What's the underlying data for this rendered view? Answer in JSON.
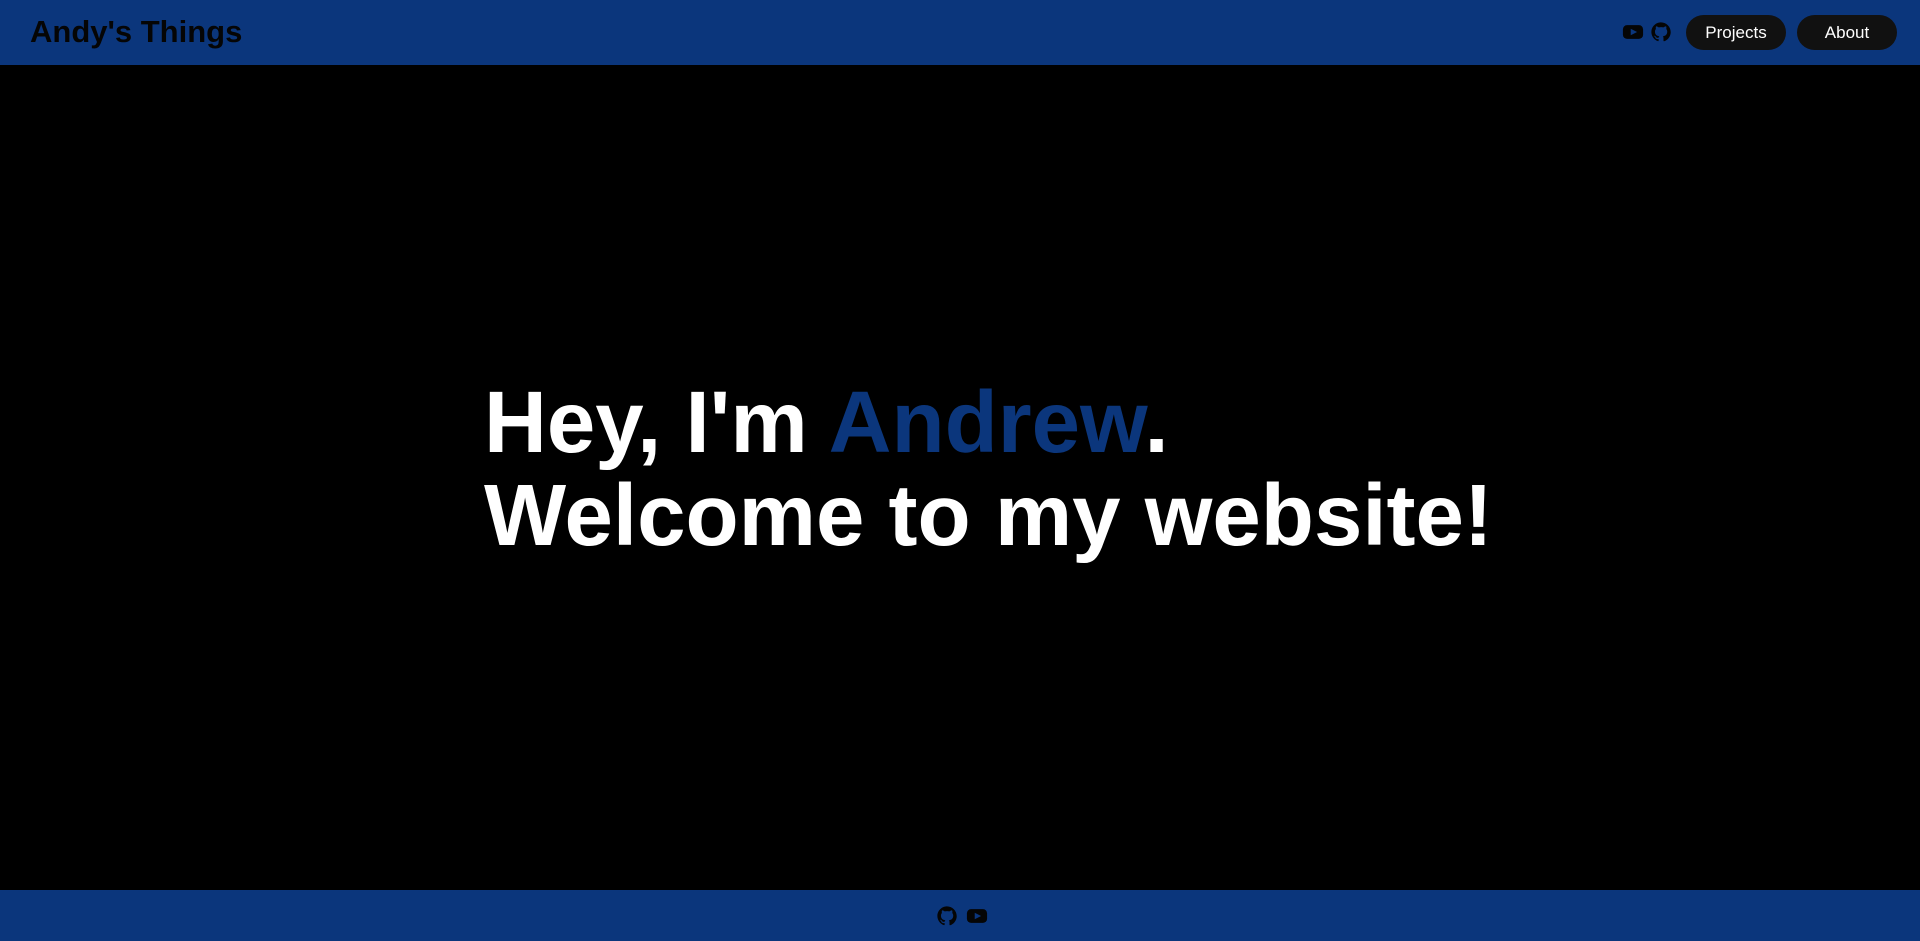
{
  "header": {
    "title": "Andy's Things",
    "icons": [
      "youtube-icon",
      "github-icon"
    ],
    "nav": [
      {
        "label": "Projects"
      },
      {
        "label": "About"
      }
    ]
  },
  "hero": {
    "line1_prefix": "Hey, I'm ",
    "line1_name": "Andrew",
    "line1_suffix": ".",
    "line2": "Welcome to my website!"
  },
  "footer": {
    "icons": [
      "github-icon",
      "youtube-icon"
    ]
  },
  "colors": {
    "brand": "#0b367c",
    "background": "#000000",
    "button": "#111111",
    "text": "#ffffff"
  }
}
